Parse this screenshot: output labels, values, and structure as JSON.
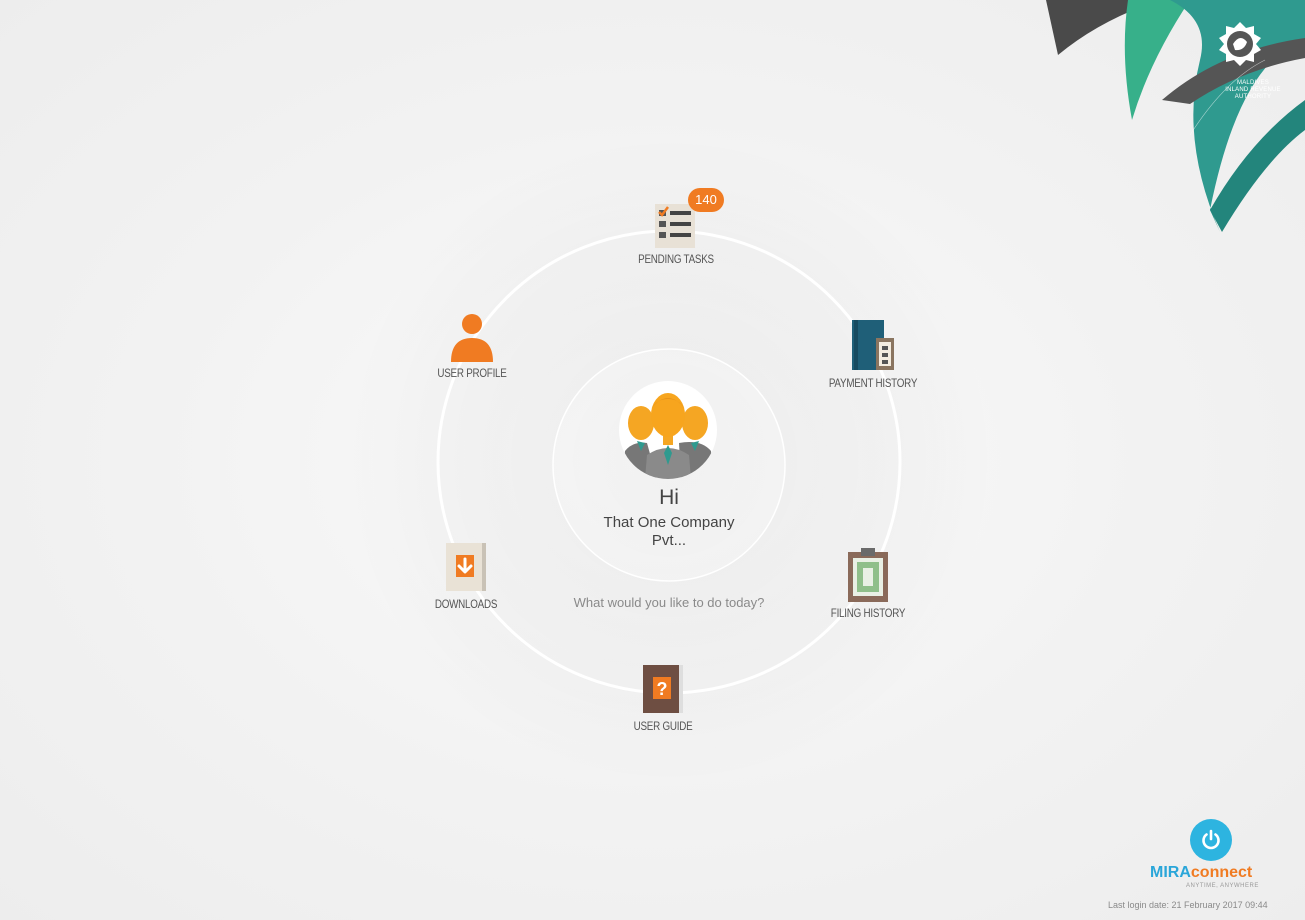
{
  "nav": [
    {
      "id": "pending-tasks",
      "label": "PENDING TASKS",
      "icon": "checklist-icon",
      "badge": "140"
    },
    {
      "id": "payment-history",
      "label": "PAYMENT HISTORY",
      "icon": "ledger-book-icon"
    },
    {
      "id": "filing-history",
      "label": "FILING HISTORY",
      "icon": "clipboard-icon"
    },
    {
      "id": "user-guide",
      "label": "USER GUIDE",
      "icon": "question-book-icon"
    },
    {
      "id": "downloads",
      "label": "DOWNLOADS",
      "icon": "download-icon"
    },
    {
      "id": "user-profile",
      "label": "USER PROFILE",
      "icon": "user-icon"
    }
  ],
  "greeting": {
    "hi": "Hi",
    "company_line1": "That One Company",
    "company_line2": "Pvt...",
    "question": "What would you like to do today?"
  },
  "logo": {
    "line1": "MALDIVES",
    "line2": "INLAND REVENUE",
    "line3": "AUTHORITY"
  },
  "brand": {
    "mira": "MIRA",
    "connect": "connect",
    "tagline": "ANYTIME, ANYWHERE"
  },
  "last_login": "Last login date: 21 February 2017 09:44",
  "colors": {
    "accent_orange": "#f07b22",
    "accent_blue": "#2db4e0",
    "logo_teal": "#2f9a8f",
    "logo_dark": "#4a4a4a"
  }
}
